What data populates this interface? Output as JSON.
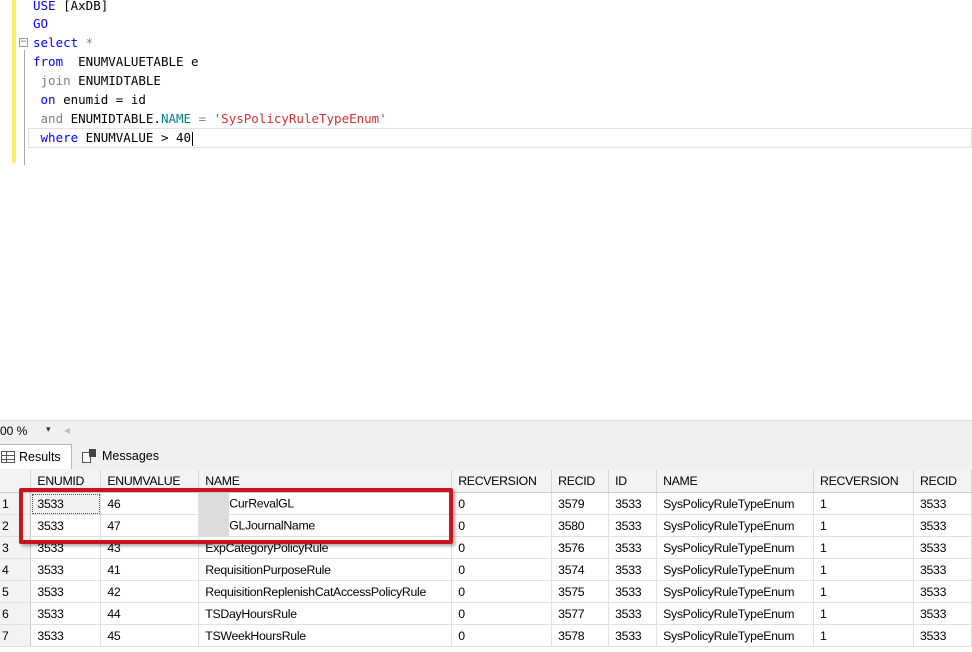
{
  "editor": {
    "lines": [
      {
        "k": "USE",
        "t": " [AxDB]"
      },
      {
        "k": "GO",
        "t": ""
      },
      {
        "k": "select",
        "t": " *"
      },
      {
        "k": "from",
        "t": "  ENUMVALUETABLE e"
      },
      {
        "g": " join",
        "t": " ENUMIDTABLE"
      },
      {
        "k": " on",
        "t": " enumid = id"
      },
      {
        "g": " and",
        "t": " ENUMIDTABLE.",
        "f": "NAME",
        "t2": " = ",
        "s": "'SysPolicyRuleTypeEnum'"
      },
      {
        "k": " where",
        "t": " ENUMVALUE > 40"
      }
    ]
  },
  "zoom": {
    "value": "00 %",
    "arrow": "▾",
    "scroll_left": "◂"
  },
  "tabs": {
    "results": "Results",
    "messages": "Messages"
  },
  "grid": {
    "columns": [
      "ENUMID",
      "ENUMVALUE",
      "NAME",
      "RECVERSION",
      "RECID",
      "ID",
      "NAME",
      "RECVERSION",
      "RECID"
    ],
    "rows": [
      {
        "num": "1",
        "cells": [
          "3533",
          "46",
          "CurRevalGL",
          "0",
          "3579",
          "3533",
          "SysPolicyRuleTypeEnum",
          "1",
          "3533"
        ],
        "blur": true
      },
      {
        "num": "2",
        "cells": [
          "3533",
          "47",
          "GLJournalName",
          "0",
          "3580",
          "3533",
          "SysPolicyRuleTypeEnum",
          "1",
          "3533"
        ],
        "blur": true
      },
      {
        "num": "3",
        "cells": [
          "3533",
          "43",
          "ExpCategoryPolicyRule",
          "0",
          "3576",
          "3533",
          "SysPolicyRuleTypeEnum",
          "1",
          "3533"
        ]
      },
      {
        "num": "4",
        "cells": [
          "3533",
          "41",
          "RequisitionPurposeRule",
          "0",
          "3574",
          "3533",
          "SysPolicyRuleTypeEnum",
          "1",
          "3533"
        ]
      },
      {
        "num": "5",
        "cells": [
          "3533",
          "42",
          "RequisitionReplenishCatAccessPolicyRule",
          "0",
          "3575",
          "3533",
          "SysPolicyRuleTypeEnum",
          "1",
          "3533"
        ]
      },
      {
        "num": "6",
        "cells": [
          "3533",
          "44",
          "TSDayHoursRule",
          "0",
          "3577",
          "3533",
          "SysPolicyRuleTypeEnum",
          "1",
          "3533"
        ]
      },
      {
        "num": "7",
        "cells": [
          "3533",
          "45",
          "TSWeekHoursRule",
          "0",
          "3578",
          "3533",
          "SysPolicyRuleTypeEnum",
          "1",
          "3533"
        ]
      }
    ]
  },
  "colors": {
    "highlight": "#c8141e",
    "keyword": "#0000ff",
    "string": "#d03030"
  }
}
